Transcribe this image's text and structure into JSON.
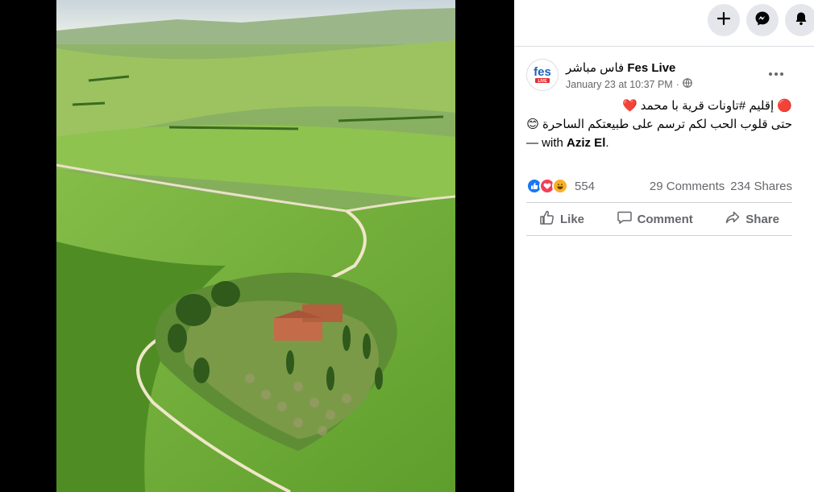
{
  "topbar": {
    "buttons": [
      {
        "name": "create",
        "icon": "plus-icon"
      },
      {
        "name": "messenger",
        "icon": "messenger-icon"
      },
      {
        "name": "notifications",
        "icon": "bell-icon"
      }
    ]
  },
  "post": {
    "author_ar": "فاس مباشر",
    "author_en": "Fes Live",
    "date": "January 23 at 10:37 PM",
    "audience_sep": "·",
    "line1": "🔴 إقليم #تاونات قرية با محمد ❤️",
    "line2": "حتى قلوب الحب لكم ترسم على طبيعتكم الساحرة 😊",
    "with_prefix": "— with ",
    "with_name": "Aziz El",
    "with_suffix": ".",
    "reaction_count": "554",
    "comments": "29 Comments",
    "shares": "234 Shares",
    "actions": {
      "like": "Like",
      "comment": "Comment",
      "share": "Share"
    }
  },
  "colors": {
    "accent": "#1877f2",
    "love": "#f33e58",
    "haha": "#f7b125",
    "muted": "#65676b"
  }
}
